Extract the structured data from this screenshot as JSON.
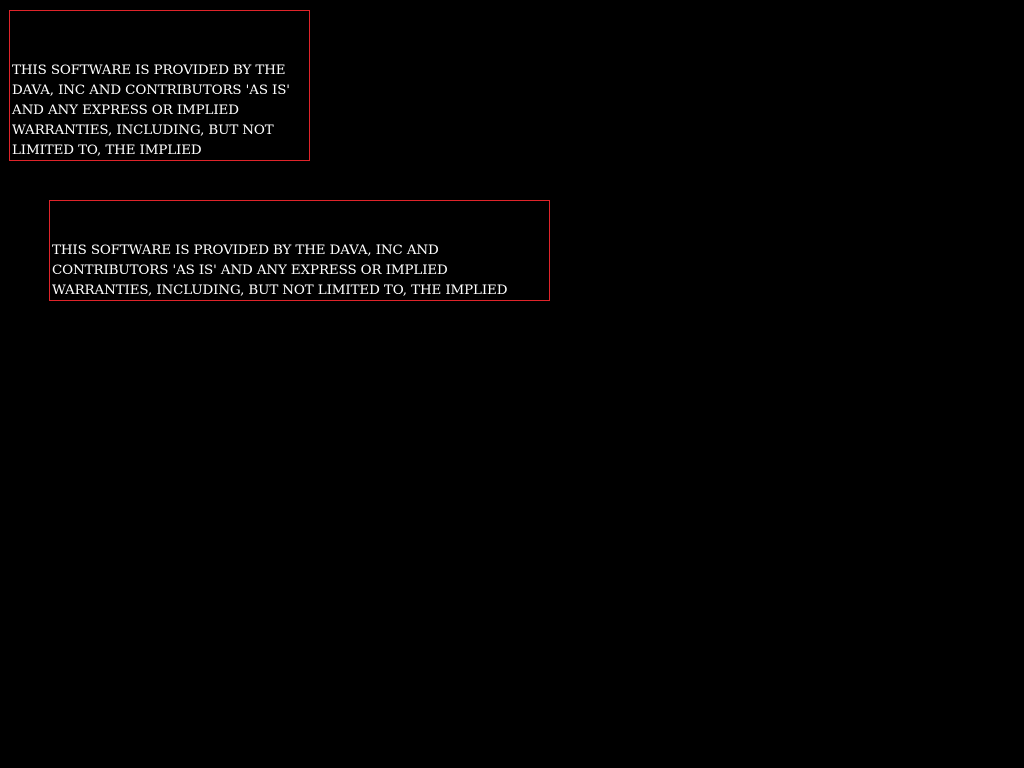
{
  "colors": {
    "background": "#000000",
    "box_border": "#e0242a",
    "text": "#ffffff"
  },
  "boxes": [
    {
      "text": "THIS SOFTWARE IS PROVIDED BY THE DAVA, INC AND CONTRIBUTORS 'AS IS' AND ANY EXPRESS OR IMPLIED WARRANTIES, INCLUDING, BUT NOT LIMITED TO, THE IMPLIED"
    },
    {
      "text": "THIS SOFTWARE IS PROVIDED BY THE DAVA, INC AND CONTRIBUTORS 'AS IS' AND ANY EXPRESS OR IMPLIED WARRANTIES, INCLUDING, BUT NOT LIMITED TO, THE IMPLIED"
    }
  ]
}
